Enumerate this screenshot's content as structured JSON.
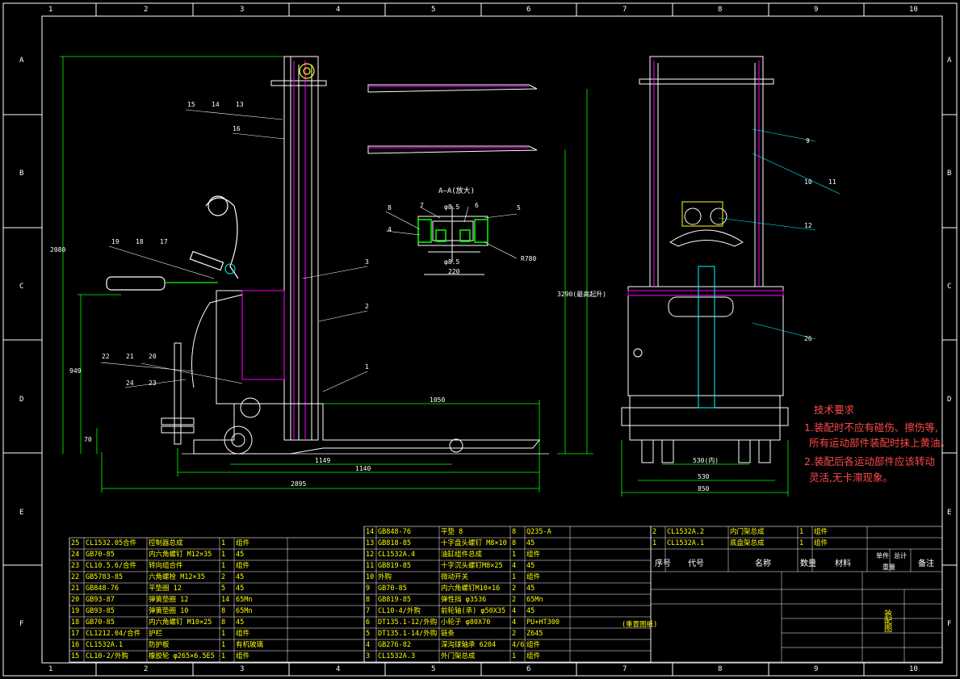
{
  "border": {
    "columns": [
      "1",
      "2",
      "3",
      "4",
      "5",
      "6",
      "7",
      "8",
      "9",
      "10"
    ],
    "rows": [
      "A",
      "B",
      "C",
      "D",
      "E",
      "F"
    ]
  },
  "section_title": "A—A(放大)",
  "tech_requirements": {
    "title": "技术要求",
    "lines": [
      "1.装配时不应有碰伤、擦伤等,",
      "所有运动部件装配时抹上黄油。",
      "2.装配后各运动部件应该转动",
      "灵活,无卡滞现象。"
    ]
  },
  "dimensions": {
    "side_total": "2895",
    "side_mid": "1140",
    "side_inner": "1149",
    "side_fork": "1050",
    "side_height": "2080",
    "side_h2": "949",
    "side_h3": "70",
    "mast_height": "3290(最高起升)",
    "front_a": "530(内)",
    "front_b": "530",
    "front_c": "850",
    "section_a": "φ8.5",
    "section_b": "φ8.5",
    "section_c": "220",
    "section_r": "R780"
  },
  "balloons_left": [
    "15",
    "14",
    "13",
    "16",
    "19",
    "18",
    "17",
    "3",
    "2",
    "1",
    "22",
    "21",
    "20",
    "24",
    "23"
  ],
  "balloons_section": [
    "8",
    "7",
    "6",
    "5",
    "4"
  ],
  "balloons_front": [
    "9",
    "10",
    "11",
    "12",
    "26"
  ],
  "bom_left": [
    [
      "25",
      "CL1532.05合件",
      "控制器总成",
      "1",
      "组件",
      ""
    ],
    [
      "24",
      "GB70-85",
      "内六角螺钉 M12×35",
      "1",
      "45",
      ""
    ],
    [
      "23",
      "CL10.5.6/合件",
      "转向组合件",
      "1",
      "组件",
      ""
    ],
    [
      "22",
      "GB5783-85",
      "六角螺栓 M12×35",
      "2",
      "45",
      ""
    ],
    [
      "21",
      "GB848-76",
      "平垫圈 12",
      "5",
      "45",
      ""
    ],
    [
      "20",
      "GB93-87",
      "弹簧垫圈 12",
      "14",
      "65Mn",
      ""
    ],
    [
      "19",
      "GB93-85",
      "弹簧垫圈 10",
      "8",
      "65Mn",
      ""
    ],
    [
      "18",
      "GB70-85",
      "内六角螺钉 M10×25",
      "8",
      "45",
      ""
    ],
    [
      "17",
      "CL1212.04/合件",
      "护栏",
      "1",
      "组件",
      ""
    ],
    [
      "16",
      "CL1532A.1",
      "防护板",
      "1",
      "有机玻璃",
      ""
    ],
    [
      "15",
      "CL10-2/外购",
      "橡胶轮 φ265×6.5E5",
      "1",
      "组件",
      ""
    ]
  ],
  "bom_mid": [
    [
      "14",
      "GB848-76",
      "平垫 8",
      "8",
      "Q235-A",
      ""
    ],
    [
      "13",
      "GB818-85",
      "十字盘头螺钉 M8×10",
      "8",
      "45",
      ""
    ],
    [
      "12",
      "CL1532A.4",
      "油缸组件总成",
      "1",
      "组件",
      ""
    ],
    [
      "11",
      "GB819-85",
      "十字沉头螺钉M8×25",
      "4",
      "45",
      ""
    ],
    [
      "10",
      "外购",
      "微动开关",
      "1",
      "组件",
      ""
    ],
    [
      "9",
      "GB70-85",
      "内六角螺钉M10×16",
      "2",
      "45",
      ""
    ],
    [
      "8",
      "GB819-85",
      "弹性挡 φ3536",
      "2",
      "65Mn",
      ""
    ],
    [
      "7",
      "CL10-4/外购",
      "前轮轴(承) φ50X35",
      "4",
      "45",
      ""
    ],
    [
      "6",
      "DT135.1-12/外购",
      "小轮子 φ80X70",
      "4",
      "PU+HT300",
      ""
    ],
    [
      "5",
      "DT135.1-14/外购",
      "链条",
      "2",
      "Z645",
      ""
    ],
    [
      "4",
      "GB276-82",
      "深沟球轴承 6204",
      "4/6",
      "组件",
      ""
    ],
    [
      "3",
      "CL1532A.3",
      "外门架总成",
      "1",
      "组件",
      ""
    ]
  ],
  "bom_right": [
    [
      "2",
      "CL1532A.2",
      "内门架总成",
      "1",
      "组件",
      ""
    ],
    [
      "1",
      "CL1532A.1",
      "底盘架总成",
      "1",
      "组件",
      ""
    ]
  ],
  "bom_header": {
    "seq": "序号",
    "code": "代号",
    "name": "名称",
    "qty": "数量",
    "material": "材料",
    "single": "单件",
    "total": "总计",
    "weight": "重量",
    "remark": "备注"
  },
  "note_small": "(重置图纸)",
  "title_block_code": "装配图"
}
